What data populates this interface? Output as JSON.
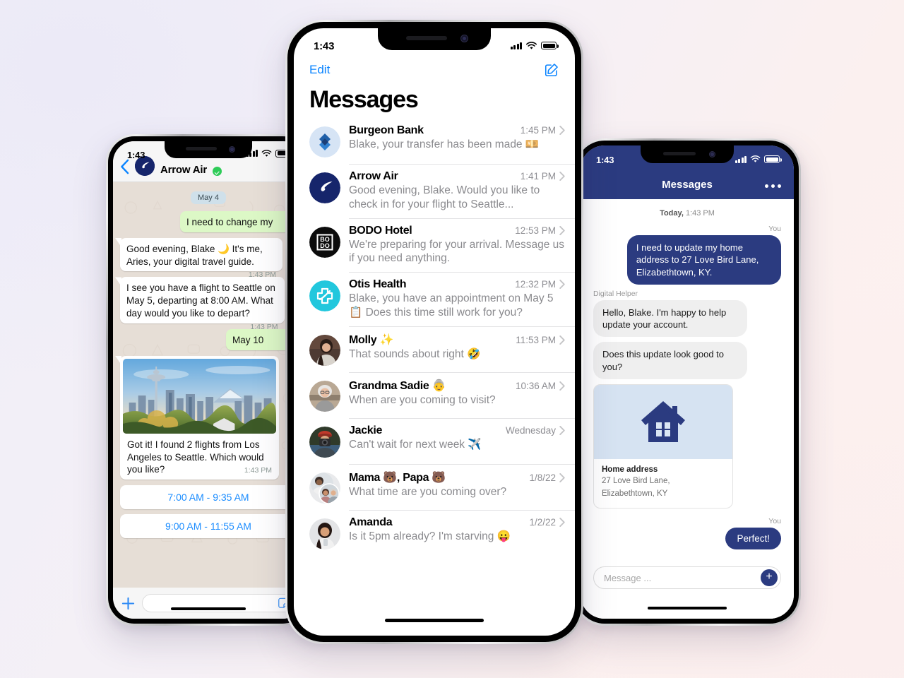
{
  "background": {
    "from": "#efeef8",
    "to": "#fdf2f0"
  },
  "phone_center": {
    "name": "iOS Messages conversation list",
    "status_bar": {
      "time": "1:43"
    },
    "nav": {
      "edit_label": "Edit",
      "compose_icon": "compose-icon"
    },
    "title": "Messages",
    "conversations": [
      {
        "avatar": "burgeon-bank-logo",
        "name": "Burgeon Bank",
        "time": "1:45 PM",
        "preview": "Blake, your transfer has been made 💴"
      },
      {
        "avatar": "arrow-air-logo",
        "name": "Arrow Air",
        "time": "1:41 PM",
        "preview": "Good evening, Blake. Would you like to check in for your flight to Seattle..."
      },
      {
        "avatar": "bodo-hotel-logo",
        "name": "BODO Hotel",
        "time": "12:53 PM",
        "preview": "We're preparing for your arrival. Message us if you need anything."
      },
      {
        "avatar": "otis-health-logo",
        "name": "Otis Health",
        "time": "12:32 PM",
        "preview": "Blake, you have an appointment on May 5 📋 Does this time still work for you?"
      },
      {
        "avatar": "molly-photo",
        "name": "Molly ✨",
        "time": "11:53 PM",
        "preview": "That sounds about right 🤣"
      },
      {
        "avatar": "grandma-sadie-photo",
        "name": "Grandma Sadie 👵",
        "time": "10:36 AM",
        "preview": "When are you coming to visit?"
      },
      {
        "avatar": "jackie-photo",
        "name": "Jackie",
        "time": "Wednesday",
        "preview": "Can't wait for next week ✈️"
      },
      {
        "avatar": "mama-papa-photo",
        "name": "Mama 🐻, Papa 🐻",
        "time": "1/8/22",
        "preview": "What time are you coming over?"
      },
      {
        "avatar": "amanda-photo",
        "name": "Amanda",
        "time": "1/2/22",
        "preview": "Is it 5pm already? I'm starving 😛"
      }
    ]
  },
  "phone_left": {
    "name": "WhatsApp chat with Arrow Air",
    "status_bar": {
      "time": "1:43"
    },
    "header": {
      "contact": "Arrow Air",
      "verified": true
    },
    "day_divider": "May 4",
    "messages": [
      {
        "side": "out",
        "text": "I need to change my",
        "time": ""
      },
      {
        "side": "in",
        "text": "Good evening, Blake 🌙 It's me, Aries, your digital travel guide.",
        "time": "1:43 PM"
      },
      {
        "side": "in",
        "text": "I see you have a flight to Seattle on May 5, departing at 8:00 AM. What day would you like to depart?",
        "time": "1:43 PM"
      },
      {
        "side": "out",
        "text": "May 10",
        "time": ""
      },
      {
        "side": "in",
        "image": "seattle-skyline-photo",
        "text": "Got it! I found 2 flights from Los Angeles to Seattle. Which would you like?",
        "time": "1:43 PM"
      }
    ],
    "choices": [
      "7:00 AM - 9:35 AM",
      "9:00 AM - 11:55 AM"
    ],
    "composer": {
      "plus_icon": "plus-icon",
      "sticker_icon": "sticker-icon",
      "placeholder": ""
    }
  },
  "phone_right": {
    "name": "Digital helper messenger",
    "status_bar": {
      "time": "1:43"
    },
    "topbar": {
      "title": "Messages",
      "menu_icon": "more-options-icon"
    },
    "day_divider": {
      "day": "Today,",
      "time": "1:43 PM"
    },
    "messages": [
      {
        "side": "me",
        "label": "You",
        "text": "I need to update my home address to 27 Love Bird Lane, Elizabethtown, KY."
      },
      {
        "side": "them",
        "label": "Digital Helper",
        "text": "Hello, Blake. I'm happy to help update your account."
      },
      {
        "side": "them",
        "label": "",
        "text": "Does this update look good to you?"
      }
    ],
    "address_card": {
      "hero_icon": "house-icon",
      "key": "Home address",
      "value_line1": "27 Love Bird Lane,",
      "value_line2": "Elizabethtown, KY"
    },
    "final": {
      "label": "You",
      "text": "Perfect!"
    },
    "composer": {
      "placeholder": "Message ...",
      "add_icon": "plus-icon"
    }
  }
}
